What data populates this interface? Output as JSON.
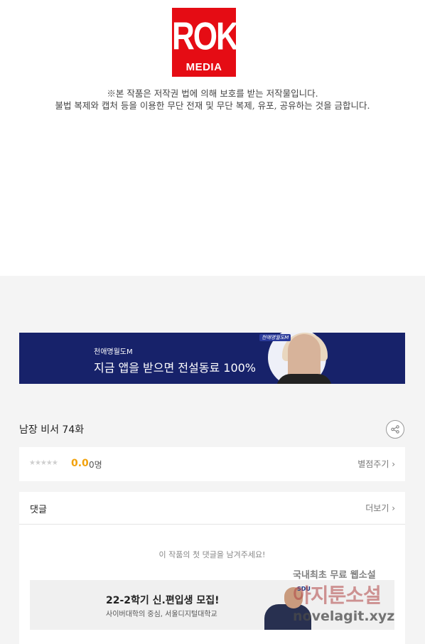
{
  "publisher": {
    "logo_main": "ROK",
    "logo_sub": "MEDIA",
    "brand_color": "#e50c14",
    "notice_line1": "※본 작품은 저작권 법에 의해 보호를 받는 저작물입니다.",
    "notice_line2": "불법 복제와 캡처 등을 이용한 무단 전재 및 무단 복제, 유포, 공유하는 것을 금합니다."
  },
  "banner": {
    "title": "천애명월도M",
    "text": "지금 앱을 받으면 전설동료 100%",
    "badge": "천애명월도M",
    "background": "#17226a"
  },
  "episode": {
    "title": "남장 비서 74화",
    "share_icon": "share-icon"
  },
  "rating": {
    "stars": "★★★★★",
    "score": "0.0",
    "count": "0명",
    "rate_label": "별점주기 ›",
    "score_color": "#f2a20c"
  },
  "comments": {
    "title": "댓글",
    "more_label": "더보기 ›",
    "empty_message": "이 작품의 첫 댓글을 남겨주세요!"
  },
  "ad": {
    "title": "22-2학기 신.편입생 모집!",
    "subtitle": "사이버대학의 중심, 서울디지털대학교",
    "logo": "SDU"
  },
  "watermark": {
    "line1": "국내최초 무료 웹소설",
    "line2": "아지툰소설",
    "line3": "novelagit.xyz"
  }
}
